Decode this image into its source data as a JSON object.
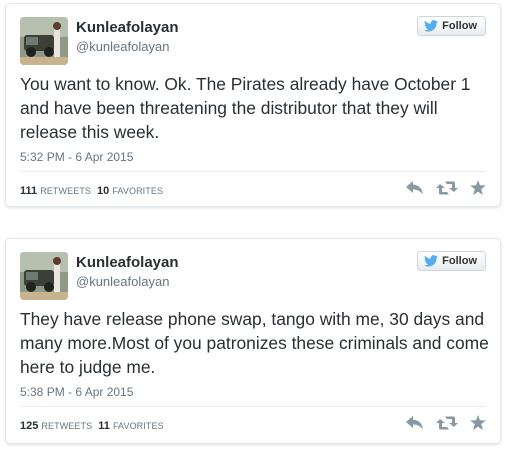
{
  "tweets": [
    {
      "display_name": "Kunleafolayan",
      "handle": "@kunleafolayan",
      "follow_label": "Follow",
      "text": "You want to know. Ok. The Pirates already have October 1 and have been threatening the distributor that they will release this week.",
      "timestamp": "5:32 PM - 6 Apr 2015",
      "retweets_count": "111",
      "retweets_label": "RETWEETS",
      "favorites_count": "10",
      "favorites_label": "FAVORITES"
    },
    {
      "display_name": "Kunleafolayan",
      "handle": "@kunleafolayan",
      "follow_label": "Follow",
      "text": "They have release phone swap, tango with me, 30 days and many more.Most of you patronizes these criminals and come here to judge me.",
      "timestamp": "5:38 PM - 6 Apr 2015",
      "retweets_count": "125",
      "retweets_label": "RETWEETS",
      "favorites_count": "11",
      "favorites_label": "FAVORITES"
    }
  ],
  "icons": {
    "follow": "twitter-bird-icon",
    "reply": "reply-icon",
    "retweet": "retweet-icon",
    "favorite": "star-icon"
  },
  "colors": {
    "twitter_blue": "#55acee",
    "text": "#292f33",
    "muted": "#66757f",
    "action_icon": "#8899a6"
  }
}
